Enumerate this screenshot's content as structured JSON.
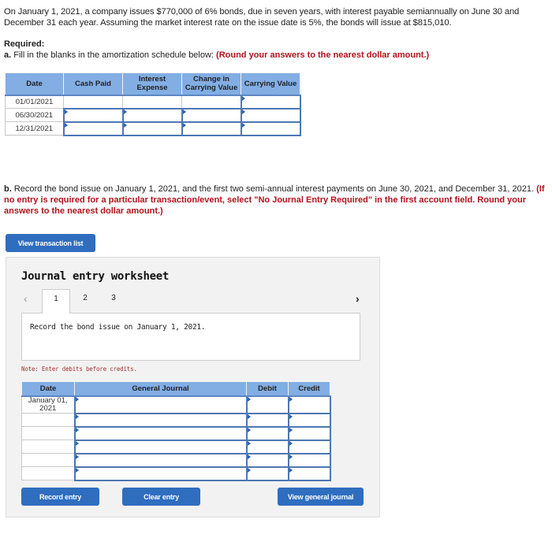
{
  "intro": {
    "text": "On January 1, 2021, a company issues $770,000 of 6% bonds, due in seven years, with interest payable semiannually on June 30 and December 31 each year. Assuming the market interest rate on the issue date is 5%, the bonds will issue at $815,010."
  },
  "required_label": "Required:",
  "part_a": {
    "label": "a.",
    "text": " Fill in the blanks in the amortization schedule below: ",
    "instruction": "(Round your answers to the nearest dollar amount.)"
  },
  "amortization": {
    "headers": [
      "Date",
      "Cash Paid",
      "Interest Expense",
      "Change in Carrying Value",
      "Carrying Value"
    ],
    "rows": [
      {
        "date": "01/01/2021",
        "cash_paid": "",
        "interest_expense": "",
        "change_in_carrying_value": "",
        "carrying_value": ""
      },
      {
        "date": "06/30/2021",
        "cash_paid": "",
        "interest_expense": "",
        "change_in_carrying_value": "",
        "carrying_value": ""
      },
      {
        "date": "12/31/2021",
        "cash_paid": "",
        "interest_expense": "",
        "change_in_carrying_value": "",
        "carrying_value": ""
      }
    ]
  },
  "part_b": {
    "label": "b.",
    "text": " Record the bond issue on January 1, 2021, and the first two semi-annual interest payments on June 30, 2021, and December 31, 2021. ",
    "instruction": "(If no entry is required for a particular transaction/event, select \"No Journal Entry Required\" in the first account field. Round your answers to the nearest dollar amount.)"
  },
  "buttons": {
    "view_transaction_list": "View transaction list",
    "record_entry": "Record entry",
    "clear_entry": "Clear entry",
    "view_general_journal": "View general journal"
  },
  "worksheet": {
    "title": "Journal entry worksheet",
    "prev_icon": "chevron-left-icon",
    "next_icon": "chevron-right-icon",
    "tabs": [
      {
        "label": "1",
        "active": true
      },
      {
        "label": "2",
        "active": false
      },
      {
        "label": "3",
        "active": false
      }
    ],
    "description": "Record the bond issue on January 1, 2021.",
    "note": "Note: Enter debits before credits.",
    "journal": {
      "headers": [
        "Date",
        "General Journal",
        "Debit",
        "Credit"
      ],
      "rows": [
        {
          "date": "January 01, 2021",
          "account": "",
          "debit": "",
          "credit": ""
        },
        {
          "date": "",
          "account": "",
          "debit": "",
          "credit": ""
        },
        {
          "date": "",
          "account": "",
          "debit": "",
          "credit": ""
        },
        {
          "date": "",
          "account": "",
          "debit": "",
          "credit": ""
        },
        {
          "date": "",
          "account": "",
          "debit": "",
          "credit": ""
        },
        {
          "date": "",
          "account": "",
          "debit": "",
          "credit": ""
        }
      ]
    }
  },
  "colors": {
    "header_blue": "#82aee4",
    "button_blue": "#2f6dbf",
    "instruction_red": "#b3121b",
    "note_red": "#a13030"
  }
}
